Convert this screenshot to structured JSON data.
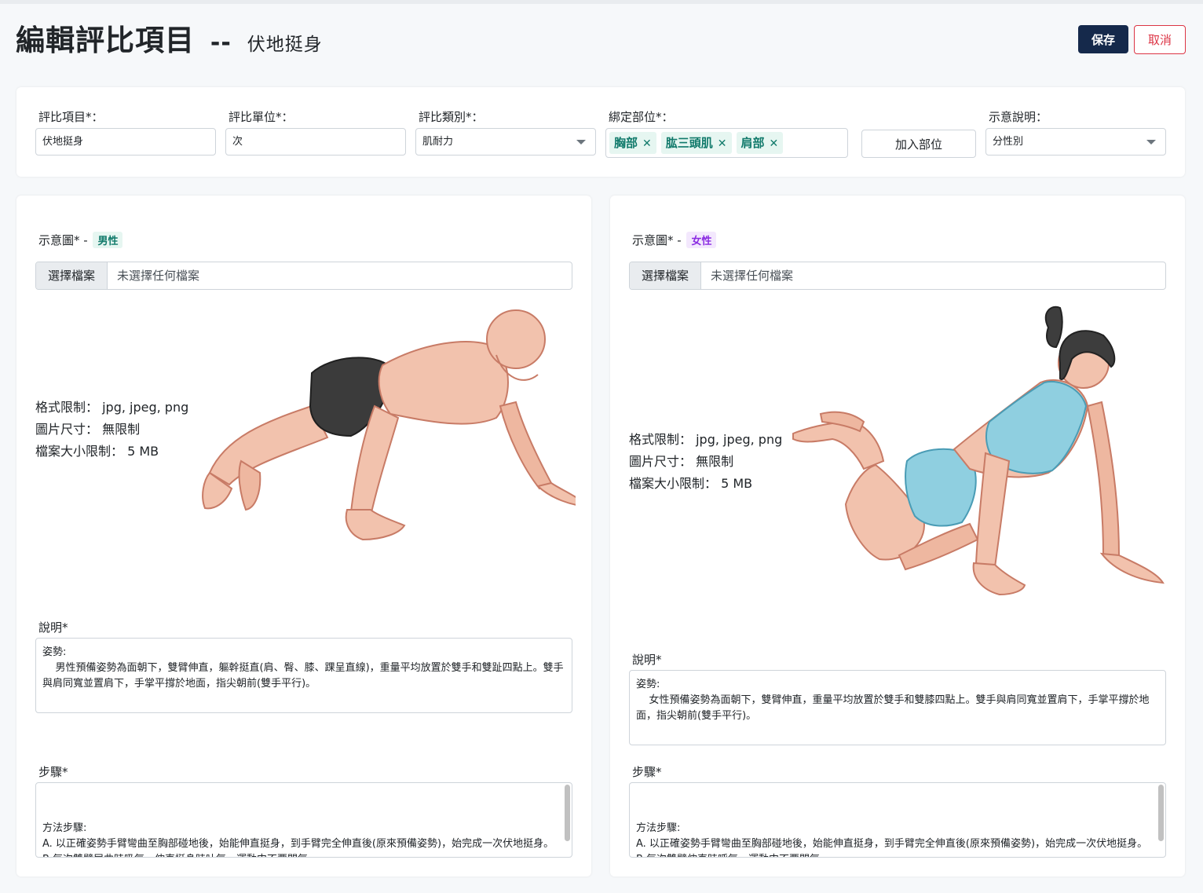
{
  "header": {
    "title": "編輯評比項目",
    "separator": "--",
    "subtitle": "伏地挺身",
    "save_label": "保存",
    "cancel_label": "取消"
  },
  "form": {
    "item": {
      "label": "評比項目*：",
      "value": "伏地挺身"
    },
    "unit": {
      "label": "評比單位*：",
      "value": "次"
    },
    "category": {
      "label": "評比類別*：",
      "value": "肌耐力"
    },
    "parts": {
      "label": "綁定部位*：",
      "tags": [
        "胸部",
        "肱三頭肌",
        "肩部"
      ],
      "remove_glyph": "✕"
    },
    "add_part_label": "加入部位",
    "hint": {
      "label": "示意說明：",
      "value": "分性別"
    }
  },
  "male": {
    "image_label": "示意圖* -",
    "badge": "男性",
    "file_button": "選擇檔案",
    "file_status": "未選擇任何檔案",
    "format": "格式限制： jpg, jpeg, png",
    "size": "圖片尺寸： 無限制",
    "filesize": "檔案大小限制： 5 MB",
    "desc_label": "說明*",
    "desc_text": "姿勢:\n    男性預備姿勢為面朝下，雙臂伸直，軀幹挺直(肩、臀、膝、踝呈直線)，重量平均放置於雙手和雙趾四點上。雙手與肩同寬並置肩下，手掌平撐於地面，指尖朝前(雙手平行)。",
    "steps_label": "步驟*",
    "steps_text": "方法步驟:\nA. 以正確姿勢手臂彎曲至胸部碰地後，始能伸直挺身，到手臂完全伸直後(原來預備姿勢)，始完成一次伏地挺身。\nB.每次雙臂屈曲時吸氣，伸直挺身時吐氣，運動中不要閉氣。"
  },
  "female": {
    "image_label": "示意圖* -",
    "badge": "女性",
    "file_button": "選擇檔案",
    "file_status": "未選擇任何檔案",
    "format": "格式限制： jpg, jpeg, png",
    "size": "圖片尺寸： 無限制",
    "filesize": "檔案大小限制： 5 MB",
    "desc_label": "說明*",
    "desc_text": "姿勢:\n    女性預備姿勢為面朝下，雙臂伸直，重量平均放置於雙手和雙膝四點上。雙手與肩同寬並置肩下，手掌平撐於地面，指尖朝前(雙手平行)。",
    "steps_label": "步驟*",
    "steps_text": "方法步驟:\nA. 以正確姿勢手臂彎曲至胸部碰地後，始能伸直挺身，到手臂完全伸直後(原來預備姿勢)，始完成一次伏地挺身。\nB.每次雙臂伸直時呼氣，運動中不要閉氣。"
  },
  "colors": {
    "primary": "#15294b",
    "danger": "#dc3545",
    "tag_bg": "#e6f6f1",
    "tag_text": "#117a6b",
    "female_badge": "#8a2be2"
  }
}
